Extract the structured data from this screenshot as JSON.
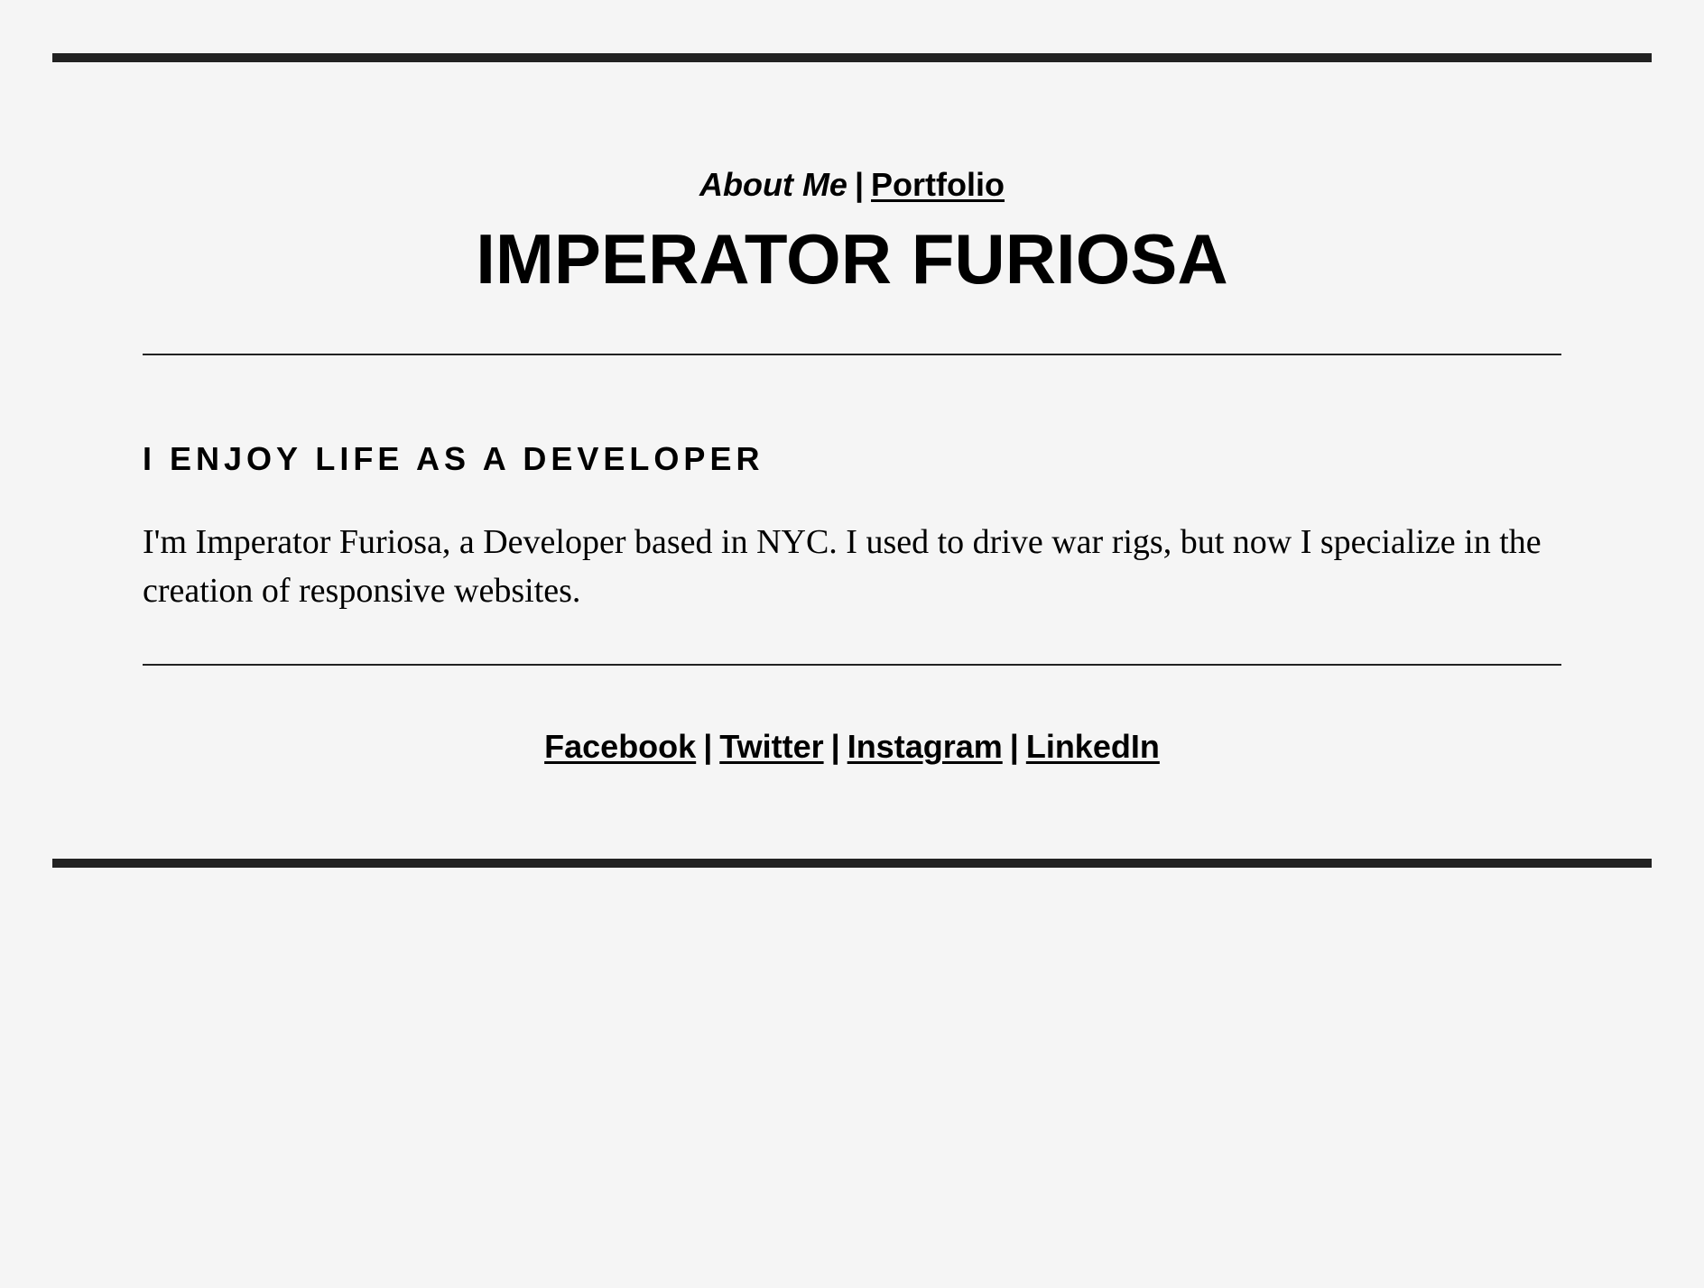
{
  "nav": {
    "current_label": "About Me",
    "separator": "|",
    "portfolio_label": "Portfolio"
  },
  "header": {
    "title": "IMPERATOR FURIOSA"
  },
  "about": {
    "heading": "I ENJOY LIFE AS A DEVELOPER",
    "body": "I'm Imperator Furiosa, a Developer based in NYC. I used to drive war rigs, but now I specialize in the creation of responsive websites."
  },
  "social": {
    "separator": "|",
    "links": [
      {
        "label": "Facebook"
      },
      {
        "label": "Twitter"
      },
      {
        "label": "Instagram"
      },
      {
        "label": "LinkedIn"
      }
    ]
  },
  "colors": {
    "background": "#f5f5f5",
    "text": "#000000",
    "border": "#222222"
  }
}
